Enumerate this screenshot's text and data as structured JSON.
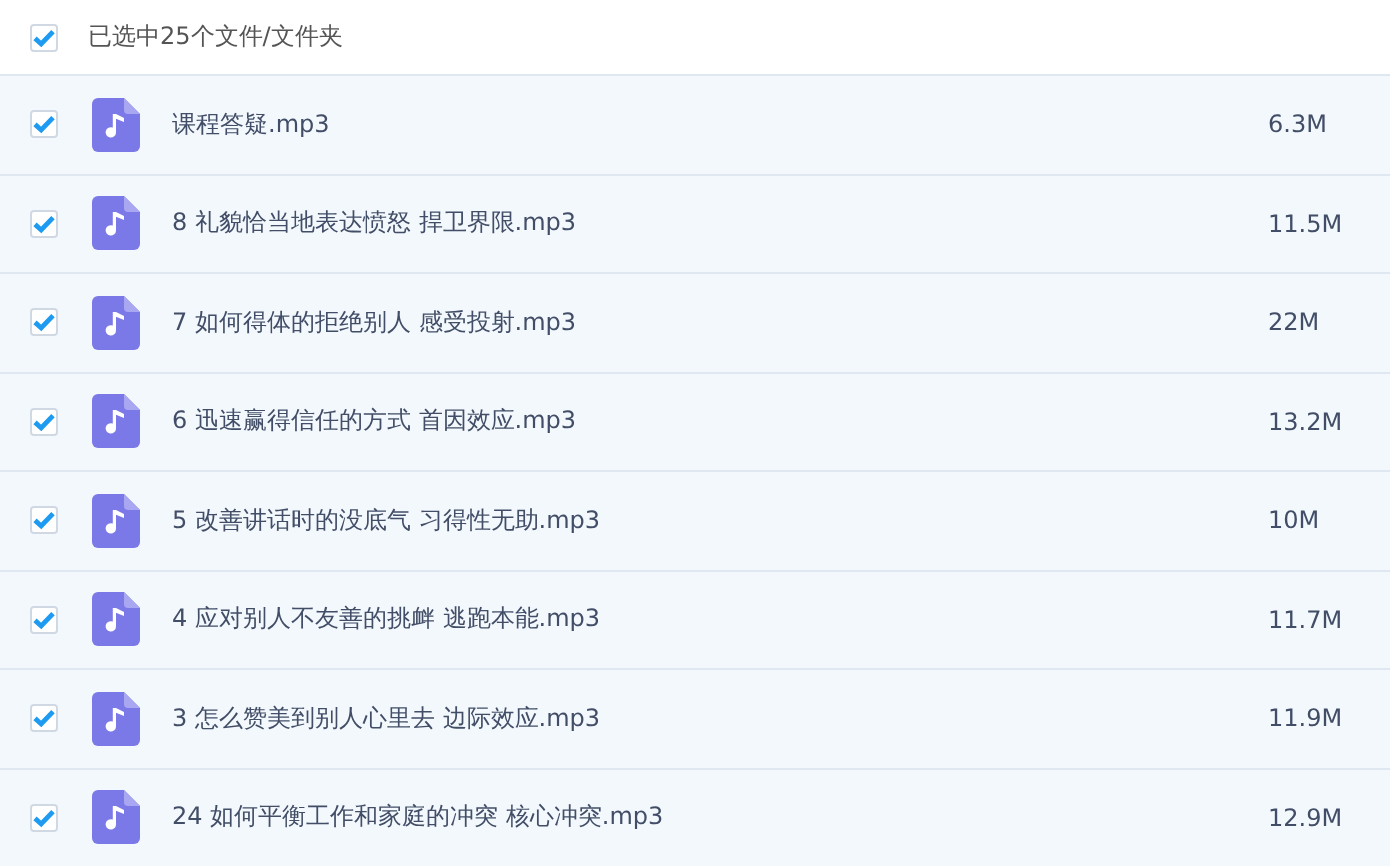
{
  "header": {
    "checked": true,
    "label": "已选中25个文件/文件夹"
  },
  "files": [
    {
      "name": "课程答疑.mp3",
      "size": "6.3M",
      "checked": true
    },
    {
      "name": "8 礼貌恰当地表达愤怒 捍卫界限.mp3",
      "size": "11.5M",
      "checked": true
    },
    {
      "name": "7 如何得体的拒绝别人 感受投射.mp3",
      "size": "22M",
      "checked": true
    },
    {
      "name": "6 迅速赢得信任的方式 首因效应.mp3",
      "size": "13.2M",
      "checked": true
    },
    {
      "name": "5 改善讲话时的没底气 习得性无助.mp3",
      "size": "10M",
      "checked": true
    },
    {
      "name": "4 应对别人不友善的挑衅 逃跑本能.mp3",
      "size": "11.7M",
      "checked": true
    },
    {
      "name": "3 怎么赞美到别人心里去 边际效应.mp3",
      "size": "11.9M",
      "checked": true
    },
    {
      "name": "24 如何平衡工作和家庭的冲突 核心冲突.mp3",
      "size": "12.9M",
      "checked": true
    }
  ]
}
